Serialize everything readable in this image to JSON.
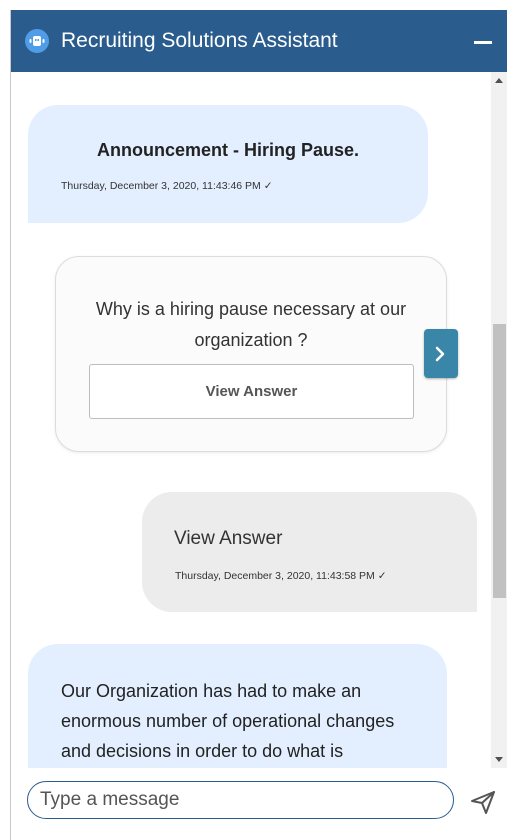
{
  "header": {
    "title": "Recruiting Solutions Assistant",
    "bot_icon": "bot-avatar-icon",
    "minimize_icon": "minimize-icon"
  },
  "messages": {
    "announcement": {
      "heading": "Announcement - Hiring Pause.",
      "timestamp": "Thursday, December 3, 2020, 11:43:46 PM ✓"
    },
    "card": {
      "question": "Why is a hiring pause necessary at our organization ?",
      "button_label": "View Answer",
      "next_icon": "chevron-right-icon"
    },
    "user_reply": {
      "text": "View Answer",
      "timestamp": "Thursday, December 3, 2020, 11:43:58 PM ✓"
    },
    "bot_answer": {
      "text": "Our Organization has had to make an enormous number of operational changes and decisions in order to do what is necessary to help mitigate"
    }
  },
  "footer": {
    "placeholder": "Type a message",
    "value": "",
    "send_icon": "send-icon"
  },
  "colors": {
    "header_bg": "#2a5c8e",
    "bot_bubble": "#e3efff",
    "user_bubble": "#ececec",
    "next_button": "#3a86a8"
  }
}
